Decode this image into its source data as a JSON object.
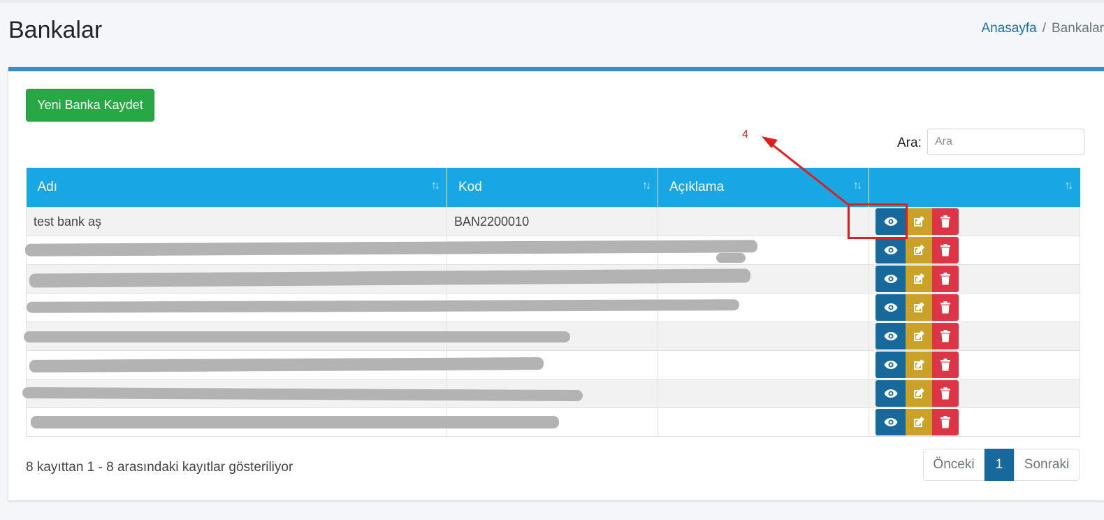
{
  "page": {
    "title": "Bankalar",
    "breadcrumb": {
      "home": "Anasayfa",
      "separator": "/",
      "current": "Bankalar"
    }
  },
  "toolbar": {
    "new_button": "Yeni Banka Kaydet"
  },
  "search": {
    "label": "Ara:",
    "placeholder": "Ara"
  },
  "table": {
    "columns": [
      "Adı",
      "Kod",
      "Açıklama",
      ""
    ],
    "rows": [
      {
        "name": "test bank aş",
        "code": "BAN2200010",
        "description": ""
      },
      {
        "name": "",
        "code": "",
        "description": ""
      },
      {
        "name": "",
        "code": "",
        "description": ""
      },
      {
        "name": "",
        "code": "",
        "description": ""
      },
      {
        "name": "",
        "code": "",
        "description": ""
      },
      {
        "name": "",
        "code": "",
        "description": ""
      },
      {
        "name": "",
        "code": "",
        "description": ""
      },
      {
        "name": "",
        "code": "",
        "description": ""
      }
    ],
    "action_icons": [
      "eye-icon",
      "edit-icon",
      "trash-icon"
    ]
  },
  "footer": {
    "info": "8 kayıttan 1 - 8 arasındaki kayıtlar gösteriliyor",
    "pagination": {
      "prev": "Önceki",
      "current": "1",
      "next": "Sonraki"
    }
  },
  "annotation": {
    "step_number": "4",
    "color": "#e01e1e"
  },
  "colors": {
    "header": "#17a7e4",
    "view": "#17699b",
    "edit": "#c9a227",
    "delete": "#dc3545",
    "success": "#28a745",
    "card_accent": "#3d89c2"
  }
}
